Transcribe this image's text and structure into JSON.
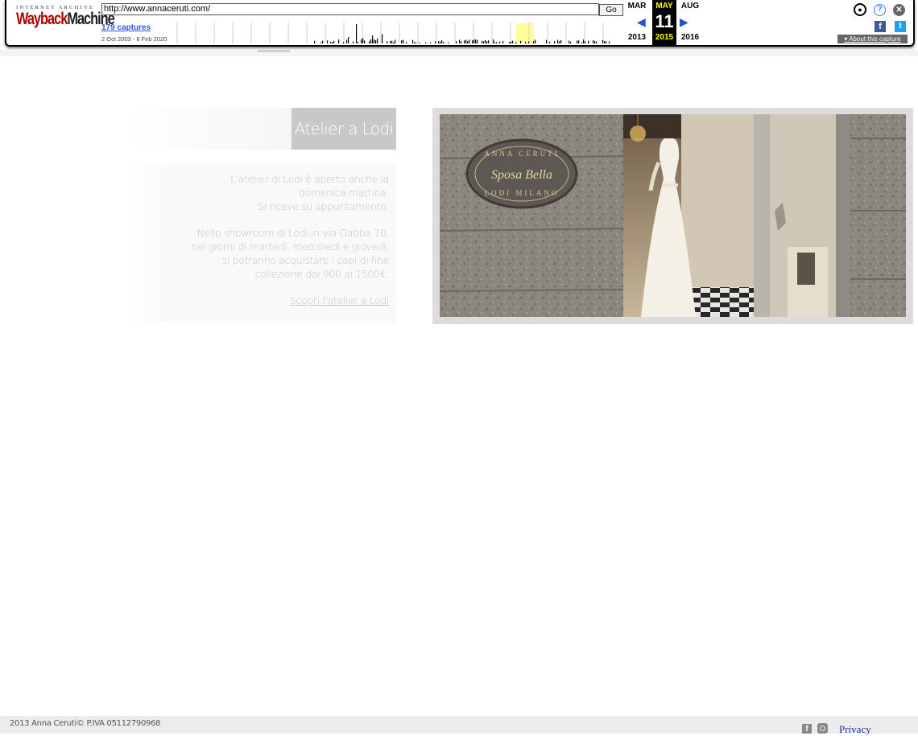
{
  "wayback": {
    "logo_top": "INTERNET ARCHIVE",
    "logo_way": "Wayback",
    "logo_machine": "Machine",
    "url_value": "http://www.annaceruti.com/",
    "go_label": "Go",
    "captures_label": "179 captures",
    "date_range": "2 Oct 2003 - 8 Feb 2020",
    "months": {
      "prev": {
        "month": "MAR",
        "year": "2013"
      },
      "current": {
        "month": "MAY",
        "day": "11",
        "year": "2015"
      },
      "next": {
        "month": "AUG",
        "year": "2016"
      }
    },
    "about_label": "About this capture",
    "colors": {
      "highlight": "#ffff00",
      "link": "#2d5bd3",
      "logo_red": "#b30000"
    },
    "icons": [
      "user-icon",
      "help-icon",
      "close-icon",
      "facebook-icon",
      "twitter-icon"
    ]
  },
  "content": {
    "title": "Atelier a Lodi",
    "paragraph1_lines": [
      "L'atelier di Lodi è aperto anche la",
      "domenica mattina.",
      "Si riceve su appuntamento."
    ],
    "paragraph2_lines": [
      "Nello showroom di Lodi,in via Gabba 10,",
      "nei giorni di martedì, mercoledì e giovedì,",
      "si potranno acquistare i capi di fine",
      "collezione dai 900 ai 1500€."
    ],
    "link_text": "Scopri l'atelier a Lodi",
    "sign_text_top": "ANNA CERUTI",
    "sign_text_mid": "Sposa Bella",
    "sign_text_bottom": "LODI MILANO"
  },
  "footer": {
    "copyright": "2013 Anna Ceruti© P.IVA 05112790968",
    "privacy_label": "Privacy",
    "icons": [
      "facebook-icon",
      "instagram-icon"
    ]
  }
}
